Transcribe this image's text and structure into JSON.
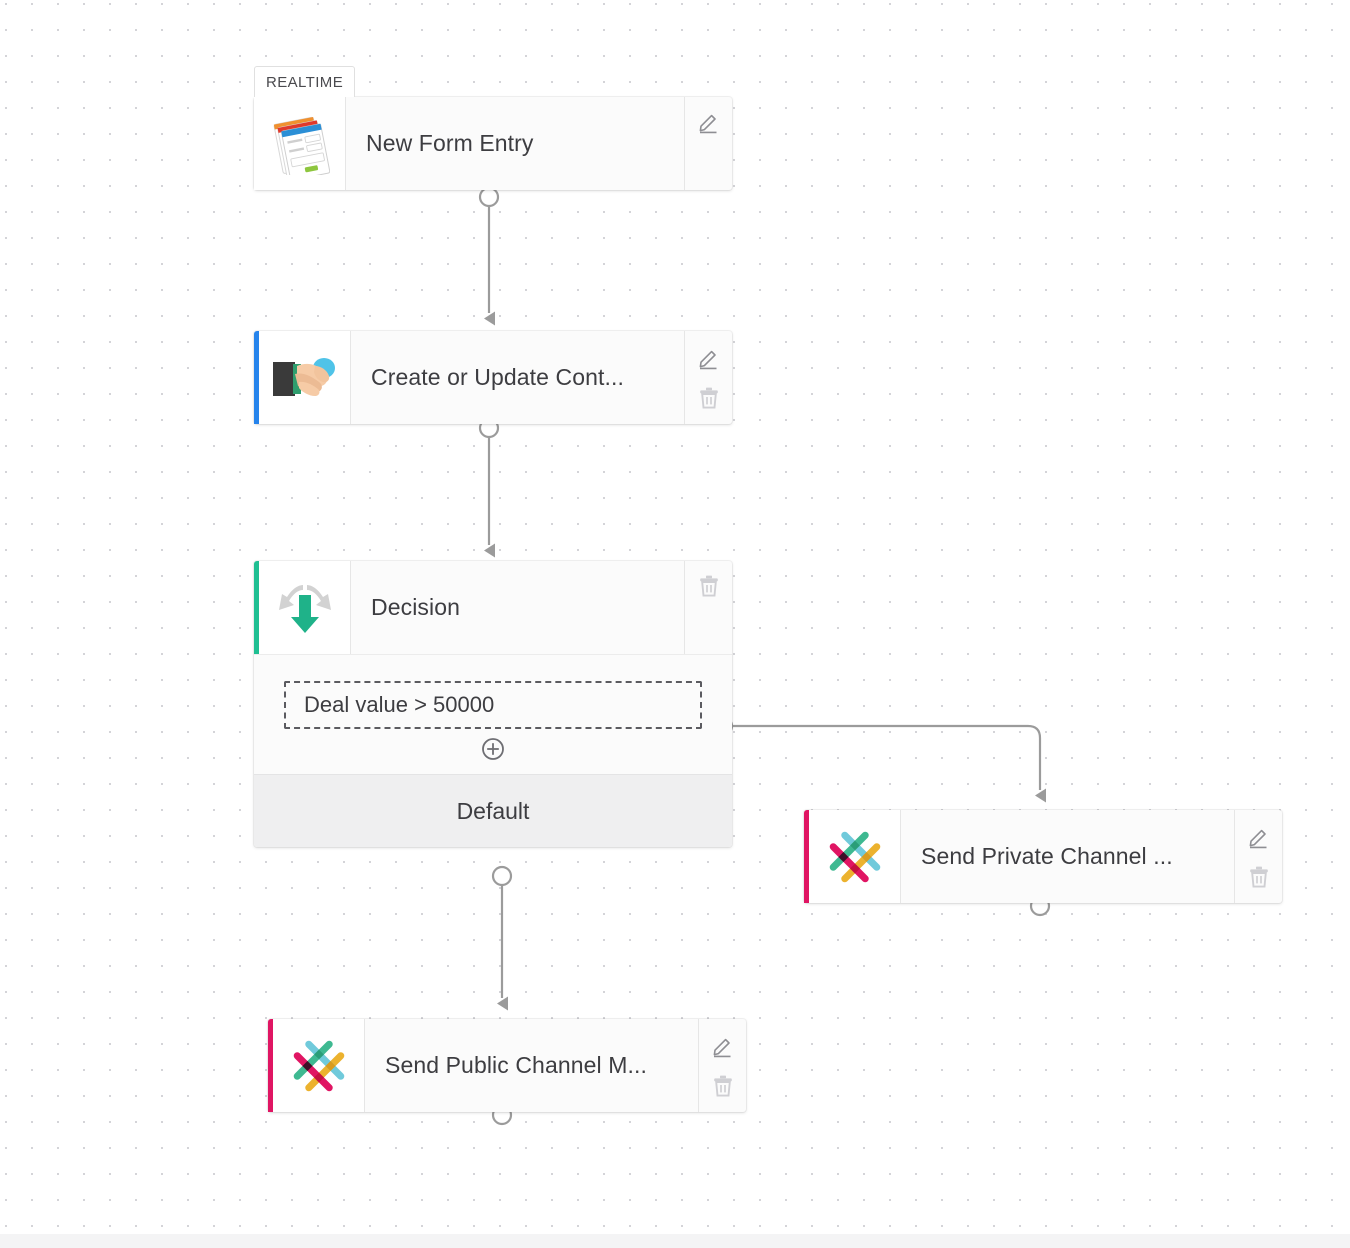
{
  "canvas": {
    "label": "workflow-canvas",
    "grid": "dotted",
    "background_color": "#ffffff",
    "dot_color": "#d4d4d8"
  },
  "nodes": [
    {
      "id": "new-form-entry",
      "title": "New Form Entry",
      "badge": "REALTIME",
      "icon": "form-stack-icon",
      "accent_color": "",
      "actions": [
        "edit-icon"
      ],
      "has_output_port": true
    },
    {
      "id": "create-or-update-contact",
      "title": "Create or Update Cont...",
      "badge": "",
      "icon": "handshake-icon",
      "accent_color": "#2684ec",
      "actions": [
        "edit-icon",
        "trash-icon"
      ],
      "has_output_port": true
    },
    {
      "id": "decision",
      "title": "Decision",
      "badge": "",
      "icon": "decision-arrows-icon",
      "accent_color": "#1fbf92",
      "actions": [
        "trash-icon"
      ],
      "has_output_port": true,
      "branches": [
        {
          "id": "deal-value-branch",
          "label": "Deal value > 50000",
          "style": "dashed"
        }
      ],
      "add_branch_icon": "plus-circle-icon",
      "default_branch_label": "Default"
    },
    {
      "id": "send-private-channel-message",
      "title": "Send Private Channel ...",
      "badge": "",
      "icon": "slack-icon",
      "accent_color": "#e01563",
      "actions": [
        "edit-icon",
        "trash-icon"
      ],
      "has_output_port": true
    },
    {
      "id": "send-public-channel-message",
      "title": "Send Public Channel M...",
      "badge": "",
      "icon": "slack-icon",
      "accent_color": "#e01563",
      "actions": [
        "edit-icon",
        "trash-icon"
      ],
      "has_output_port": true
    }
  ],
  "connections": [
    {
      "from": "new-form-entry",
      "to": "create-or-update-contact",
      "shape": "straight-down"
    },
    {
      "from": "create-or-update-contact",
      "to": "decision",
      "shape": "straight-down"
    },
    {
      "from": "deal-value-branch",
      "to": "send-private-channel-message",
      "shape": "right-then-down"
    },
    {
      "from": "decision-default",
      "to": "send-public-channel-message",
      "shape": "straight-down"
    }
  ],
  "colors": {
    "connector": "#9b9b9b",
    "node_surface": "#fbfbfb",
    "icon_surface": "#ffffff",
    "default_row": "#efeff0",
    "text": "#3d3d41",
    "slack_teal": "#3eb991",
    "slack_yellow": "#ecb22e",
    "slack_pink": "#e01563",
    "slack_blue": "#70cadb",
    "decision_green": "#1fbf92",
    "arrow_gray": "#d0d0d0"
  }
}
